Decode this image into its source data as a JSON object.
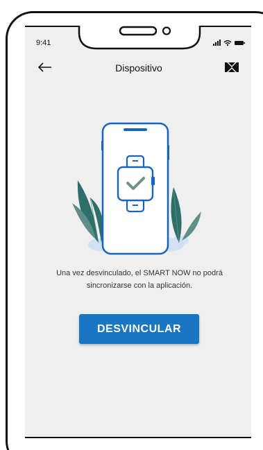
{
  "status_bar": {
    "time": "9:41",
    "icons": [
      "signal-icon",
      "wifi-icon",
      "battery-icon"
    ]
  },
  "nav": {
    "back_icon": "arrow-left-icon",
    "title": "Dispositivo",
    "logo_icon": "brand-logo-icon"
  },
  "illustration": {
    "icon": "phone-watch-check-icon"
  },
  "message": "Una vez desvinculado, el SMART NOW no podrá sincronizarse con la aplicación.",
  "button": {
    "label": "DESVINCULAR"
  },
  "colors": {
    "accent": "#1976c2",
    "background": "#efefef",
    "plant": "#2f6f6a",
    "illustration_line": "#1565c0"
  }
}
